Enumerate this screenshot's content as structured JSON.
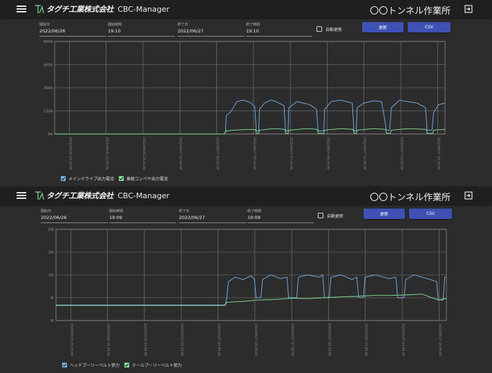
{
  "app": {
    "brand_jp": "タグチ工業株式会社",
    "app_name": "CBC-Manager",
    "site_name": "〇〇トンネル作業所",
    "logo_mark": "TK",
    "icons": {
      "menu": "hamburger-icon",
      "logout": "logout-icon",
      "checkbox": "checkbox-icon"
    }
  },
  "colors": {
    "appbar": "#1f1f1f",
    "background": "#2c2c2c",
    "button": "#3f51b5",
    "series_blue": "#7ab4ec",
    "series_green": "#86e69a",
    "grid": "#7e7e7e",
    "plot_border": "#e07c7c"
  },
  "panels": [
    {
      "filters": {
        "start_date_label": "開始日",
        "start_date": "2022/06/26",
        "start_time_label": "開始時間",
        "start_time": "19:10",
        "end_date_label": "終了日",
        "end_date": "2022/06/27",
        "end_time_label": "終了時間",
        "end_time": "19:10"
      },
      "auto_refresh_label": "自動更新",
      "auto_refresh_checked": false,
      "update_button": "更新",
      "csv_button": "CSV",
      "legend": [
        {
          "label": "メインドライブ出力電流",
          "checked": true,
          "color": "#7ab4ec"
        },
        {
          "label": "乗継コンベヤ出力電流",
          "checked": true,
          "color": "#86e69a"
        }
      ]
    },
    {
      "filters": {
        "start_date_label": "開始日",
        "start_date": "2022/06/26",
        "start_time_label": "開始時間",
        "start_time": "19:09",
        "end_date_label": "終了日",
        "end_date": "2022/06/27",
        "end_time_label": "終了時間",
        "end_time": "19:09"
      },
      "auto_refresh_label": "自動更新",
      "auto_refresh_checked": false,
      "update_button": "更新",
      "csv_button": "CSV",
      "legend": [
        {
          "label": "ヘッドプーリーベルト張力",
          "checked": true,
          "color": "#7ab4ec"
        },
        {
          "label": "テールプーリーベルト張力",
          "checked": true,
          "color": "#86e69a"
        }
      ]
    }
  ],
  "chart_data": [
    {
      "type": "line",
      "y_ticks": [
        "600A",
        "450A",
        "300A",
        "150A",
        "0A"
      ],
      "ylim": [
        0,
        600
      ],
      "grid": true,
      "x_tick_labels": [
        "2022/06/26 19:10:00",
        "2022/06/26 21:10:00",
        "2022/06/26 23:10:00",
        "2022/06/27 01:10:00",
        "2022/06/27 03:10:00",
        "2022/06/27 05:10:00",
        "2022/06/27 07:10:00",
        "2022/06/27 09:10:00",
        "2022/06/27 11:10:00",
        "2022/06/27 13:10:00",
        "2022/06/27 15:10:00"
      ],
      "x_hours": [
        0,
        24
      ],
      "series": [
        {
          "name": "メインドライブ出力電流",
          "points": [
            [
              0,
              0
            ],
            [
              10.4,
              0
            ],
            [
              10.5,
              10
            ],
            [
              10.55,
              120
            ],
            [
              10.8,
              140
            ],
            [
              11.2,
              210
            ],
            [
              11.6,
              220
            ],
            [
              12.0,
              205
            ],
            [
              12.3,
              180
            ],
            [
              12.4,
              20
            ],
            [
              12.55,
              20
            ],
            [
              12.6,
              160
            ],
            [
              12.9,
              200
            ],
            [
              13.3,
              220
            ],
            [
              13.6,
              210
            ],
            [
              14.1,
              185
            ],
            [
              14.2,
              20
            ],
            [
              14.35,
              20
            ],
            [
              14.4,
              170
            ],
            [
              14.9,
              210
            ],
            [
              15.3,
              200
            ],
            [
              15.7,
              190
            ],
            [
              16.1,
              160
            ],
            [
              16.2,
              20
            ],
            [
              16.55,
              20
            ],
            [
              16.6,
              160
            ],
            [
              17.0,
              210
            ],
            [
              17.6,
              220
            ],
            [
              18.3,
              200
            ],
            [
              18.4,
              20
            ],
            [
              18.55,
              20
            ],
            [
              18.6,
              170
            ],
            [
              19.0,
              200
            ],
            [
              19.6,
              215
            ],
            [
              20.1,
              210
            ],
            [
              20.4,
              25
            ],
            [
              20.6,
              25
            ],
            [
              20.7,
              170
            ],
            [
              21.2,
              220
            ],
            [
              21.7,
              210
            ],
            [
              22.3,
              200
            ],
            [
              22.8,
              170
            ],
            [
              22.9,
              25
            ],
            [
              23.2,
              25
            ],
            [
              23.3,
              140
            ],
            [
              23.6,
              190
            ],
            [
              24,
              200
            ]
          ]
        },
        {
          "name": "乗継コンベヤ出力電流",
          "points": [
            [
              0,
              0
            ],
            [
              10.4,
              0
            ],
            [
              10.5,
              10
            ],
            [
              10.55,
              20
            ],
            [
              11.0,
              25
            ],
            [
              12.0,
              30
            ],
            [
              12.35,
              28
            ],
            [
              12.4,
              5
            ],
            [
              12.55,
              5
            ],
            [
              12.6,
              25
            ],
            [
              13.5,
              35
            ],
            [
              14.15,
              30
            ],
            [
              14.2,
              5
            ],
            [
              14.35,
              5
            ],
            [
              14.4,
              25
            ],
            [
              15.5,
              35
            ],
            [
              16.15,
              30
            ],
            [
              16.2,
              5
            ],
            [
              16.55,
              5
            ],
            [
              16.6,
              25
            ],
            [
              17.6,
              35
            ],
            [
              18.35,
              30
            ],
            [
              18.4,
              5
            ],
            [
              18.55,
              5
            ],
            [
              18.6,
              25
            ],
            [
              19.6,
              35
            ],
            [
              20.35,
              30
            ],
            [
              20.4,
              5
            ],
            [
              20.65,
              5
            ],
            [
              20.7,
              25
            ],
            [
              21.7,
              35
            ],
            [
              22.85,
              30
            ],
            [
              22.9,
              5
            ],
            [
              23.25,
              5
            ],
            [
              23.3,
              25
            ],
            [
              24,
              30
            ]
          ]
        }
      ]
    },
    {
      "type": "line",
      "y_ticks": [
        "20t",
        "15t",
        "10t",
        "5t",
        "0t"
      ],
      "ylim": [
        0,
        20
      ],
      "grid": true,
      "x_tick_labels": [
        "2022/06/26 19:09:00",
        "2022/06/26 21:09:00",
        "2022/06/26 23:09:00",
        "2022/06/27 01:09:00",
        "2022/06/27 03:09:00",
        "2022/06/27 05:09:00",
        "2022/06/27 07:09:00",
        "2022/06/27 09:09:00",
        "2022/06/27 11:09:00",
        "2022/06/27 13:09:00",
        "2022/06/27 15:09:00"
      ],
      "x_hours": [
        0,
        24
      ],
      "series": [
        {
          "name": "ヘッドプーリーベルト張力",
          "points": [
            [
              0,
              3.4
            ],
            [
              10.4,
              3.4
            ],
            [
              10.5,
              5.0
            ],
            [
              10.6,
              8.5
            ],
            [
              11.0,
              9.5
            ],
            [
              11.5,
              9.0
            ],
            [
              12.0,
              9.8
            ],
            [
              12.2,
              9.0
            ],
            [
              12.3,
              5.0
            ],
            [
              12.6,
              5.0
            ],
            [
              12.7,
              9.0
            ],
            [
              13.2,
              10.0
            ],
            [
              13.8,
              9.2
            ],
            [
              14.2,
              9.5
            ],
            [
              14.3,
              5.0
            ],
            [
              14.8,
              5.0
            ],
            [
              14.9,
              9.5
            ],
            [
              15.5,
              10.0
            ],
            [
              16.2,
              9.5
            ],
            [
              16.4,
              10.0
            ],
            [
              16.5,
              5.0
            ],
            [
              16.8,
              5.0
            ],
            [
              16.9,
              9.5
            ],
            [
              17.5,
              10.0
            ],
            [
              18.2,
              9.0
            ],
            [
              18.5,
              9.5
            ],
            [
              18.6,
              5.0
            ],
            [
              18.9,
              5.0
            ],
            [
              19.0,
              9.5
            ],
            [
              19.6,
              10.0
            ],
            [
              20.5,
              9.2
            ],
            [
              20.9,
              9.5
            ],
            [
              21.0,
              5.0
            ],
            [
              21.4,
              5.0
            ],
            [
              21.5,
              9.0
            ],
            [
              22.0,
              10.0
            ],
            [
              23.0,
              9.0
            ],
            [
              23.4,
              8.5
            ],
            [
              23.5,
              4.5
            ],
            [
              23.8,
              4.5
            ],
            [
              23.9,
              9.5
            ],
            [
              24,
              9.5
            ]
          ]
        },
        {
          "name": "テールプーリーベルト張力",
          "points": [
            [
              0,
              3.3
            ],
            [
              10.4,
              3.3
            ],
            [
              10.5,
              4.0
            ],
            [
              11.5,
              4.2
            ],
            [
              12.5,
              4.5
            ],
            [
              13.5,
              4.6
            ],
            [
              14.5,
              4.9
            ],
            [
              15.5,
              4.8
            ],
            [
              16.5,
              5.0
            ],
            [
              17.5,
              5.2
            ],
            [
              18.5,
              5.3
            ],
            [
              19.5,
              5.5
            ],
            [
              20.5,
              5.5
            ],
            [
              21.5,
              5.6
            ],
            [
              22.5,
              5.8
            ],
            [
              23.5,
              4.5
            ],
            [
              24,
              4.8
            ]
          ]
        }
      ]
    }
  ]
}
